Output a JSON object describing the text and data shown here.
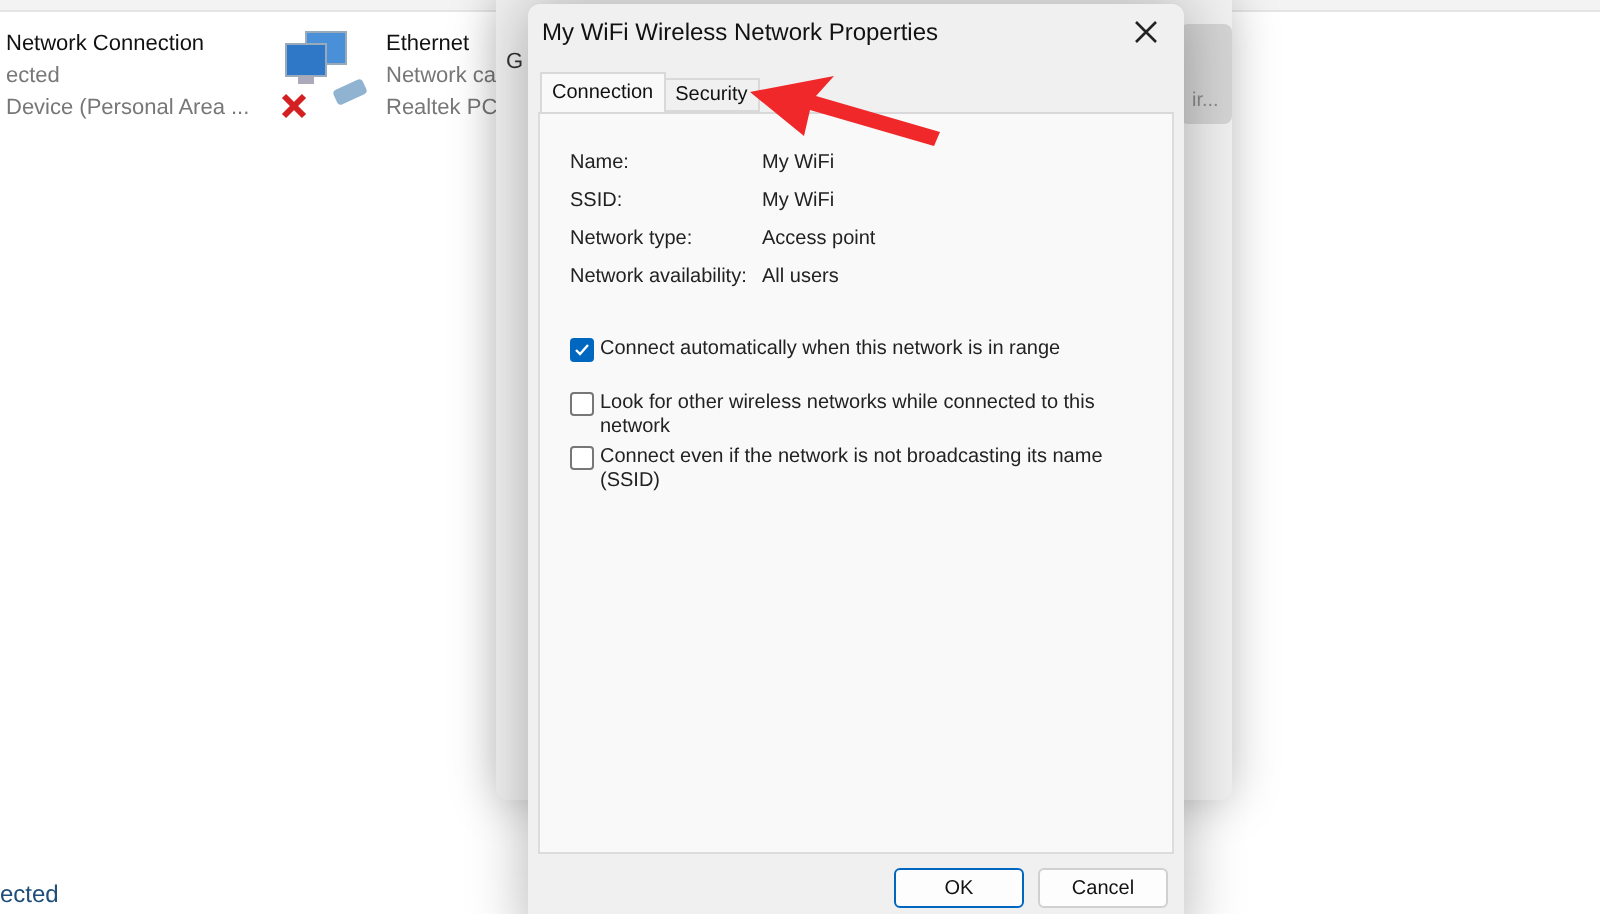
{
  "explorer": {
    "adapters": [
      {
        "name": "Network Connection",
        "status": "ected",
        "device": "Device (Personal Area ..."
      },
      {
        "name": "Ethernet",
        "status": "Network ca",
        "device": "Realtek PC",
        "disconnected": true
      }
    ],
    "footer_status": "ected"
  },
  "status_window": {
    "tab_label": "G",
    "button_label": "ir..."
  },
  "dialog": {
    "title": "My WiFi Wireless Network Properties",
    "tabs": [
      {
        "label": "Connection",
        "selected": true
      },
      {
        "label": "Security",
        "selected": false
      }
    ],
    "fields": [
      {
        "label": "Name:",
        "value": "My WiFi"
      },
      {
        "label": "SSID:",
        "value": "My WiFi"
      },
      {
        "label": "Network type:",
        "value": "Access point"
      },
      {
        "label": "Network availability:",
        "value": "All users"
      }
    ],
    "options": [
      {
        "label": "Connect automatically when this network is in range",
        "checked": true
      },
      {
        "label": "Look for other wireless networks while connected to this network",
        "checked": false
      },
      {
        "label": "Connect even if the network is not broadcasting its name (SSID)",
        "checked": false
      }
    ],
    "buttons": [
      {
        "label": "OK",
        "kind": "primary"
      },
      {
        "label": "Cancel",
        "kind": "secondary"
      }
    ]
  }
}
